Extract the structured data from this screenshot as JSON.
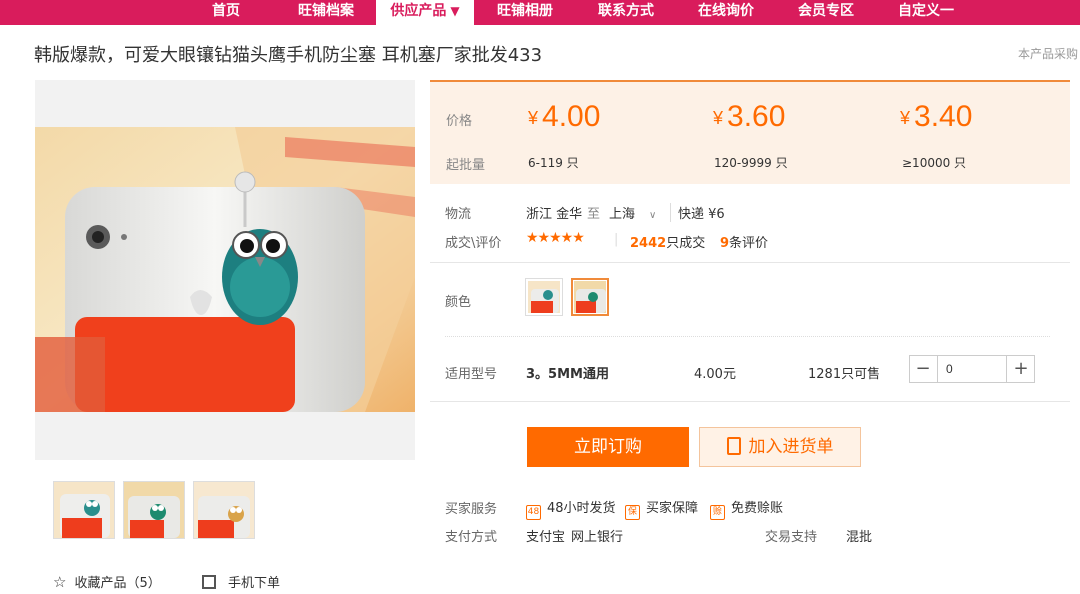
{
  "nav": {
    "items": [
      {
        "label": "首页"
      },
      {
        "label": "旺铺档案"
      },
      {
        "label": "供应产品"
      },
      {
        "label": "旺铺相册"
      },
      {
        "label": "联系方式"
      },
      {
        "label": "在线询价"
      },
      {
        "label": "会员专区"
      },
      {
        "label": "自定义一"
      }
    ],
    "active_caret": "▼"
  },
  "product": {
    "title": "韩版爆款，可爱大眼镶钻猫头鹰手机防尘塞 耳机塞厂家批发433",
    "side_note": "本产品采购"
  },
  "price": {
    "price_label": "价格",
    "moq_label": "起批量",
    "currency": "¥",
    "tiers": [
      {
        "price": "4.00",
        "range": "6-119 只"
      },
      {
        "price": "3.60",
        "range": "120-9999 只"
      },
      {
        "price": "3.40",
        "range": "≥10000 只"
      }
    ]
  },
  "logistics": {
    "label": "物流",
    "from": "浙江 金华",
    "to_word": "至",
    "to": "上海",
    "express": "快递 ¥6"
  },
  "deals": {
    "label": "成交\\评价",
    "rating_stars": 5,
    "sold_count": "2442",
    "sold_suffix": "只成交",
    "review_count": "9",
    "review_suffix": "条评价"
  },
  "color": {
    "label": "颜色"
  },
  "sku": {
    "label": "适用型号",
    "model": "3。5MM通用",
    "price": "4.00元",
    "stock": "1281只可售",
    "quantity": "0",
    "minus": "−",
    "plus": "+"
  },
  "actions": {
    "buy_label": "立即订购",
    "cart_label": "加入进货单"
  },
  "services": {
    "label": "买家服务",
    "items": [
      {
        "icon_text": "48",
        "label": "48小时发货"
      },
      {
        "icon_text": "保",
        "label": "买家保障"
      },
      {
        "icon_text": "赊",
        "label": "免费赊账"
      }
    ]
  },
  "payment": {
    "label": "支付方式",
    "methods": [
      "支付宝",
      "网上银行"
    ],
    "trade_label": "交易支持",
    "trade_value": "混批"
  },
  "gallery": {
    "fav_label": "收藏产品（5）",
    "mobile_label": "手机下单"
  },
  "colors": {
    "brand": "#d91c5c",
    "accent": "#ff6a00"
  }
}
